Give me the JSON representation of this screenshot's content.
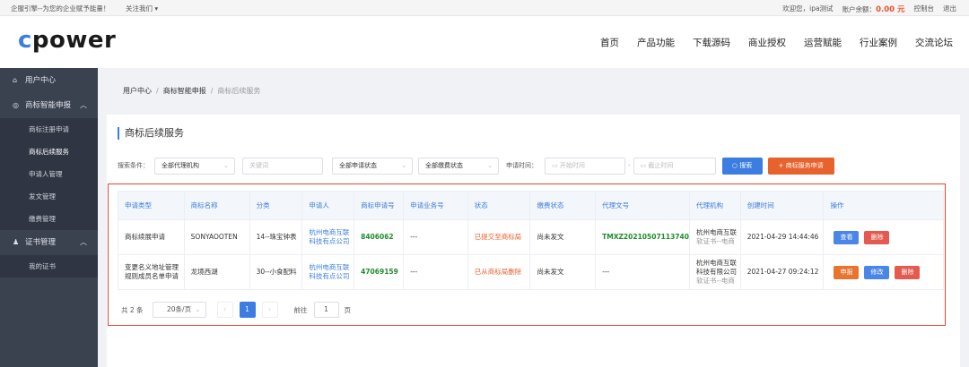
{
  "topbar": {
    "slogan": "企服引擎--为您的企业赋予能量！",
    "follow": "关注我们",
    "welcome": "欢迎您，",
    "username": "ipa测试",
    "balance_label": "账户余额：",
    "balance": "0.00 元",
    "console": "控制台",
    "logout": "退出"
  },
  "logo": {
    "c": "c",
    "rest": "power"
  },
  "nav": [
    "首页",
    "产品功能",
    "下载源码",
    "商业授权",
    "运营赋能",
    "行业案例",
    "交流论坛"
  ],
  "sidebar": {
    "user_center": "用户中心",
    "trademark": "商标智能申报",
    "trademark_items": [
      "商标注册申请",
      "商标后续服务",
      "申请人管理",
      "发文管理",
      "缴费管理"
    ],
    "certificate": "证书管理",
    "certificate_items": [
      "我的证书"
    ]
  },
  "breadcrumb": [
    "用户中心",
    "商标智能申报",
    "商标后续服务"
  ],
  "panel_title": "商标后续服务",
  "filters": {
    "label": "搜索条件：",
    "agency": "全部代理机构",
    "keyword_placeholder": "关键词",
    "apply_status": "全部申请状态",
    "pay_status": "全部缴费状态",
    "time_label": "申请时间：",
    "start_placeholder": "开始时间",
    "dash": "-",
    "end_placeholder": "截止时间",
    "search_btn": "搜索",
    "apply_btn": "+ 商标服务申请"
  },
  "table": {
    "headers": [
      "申请类型",
      "商标名称",
      "分类",
      "申请人",
      "商标申请号",
      "申请业务号",
      "状态",
      "缴费状态",
      "代理文号",
      "代理机构",
      "创建时间",
      "操作"
    ],
    "rows": [
      {
        "type": "商标续展申请",
        "name": "SONYAOOTEN",
        "category": "14--珠宝钟表",
        "applicant": "杭州电商互联科技有点公司",
        "app_no": "8406062",
        "biz_no": "---",
        "status": "已提交至商标局",
        "pay_status": "尚未发文",
        "doc_no": "TMXZ20210507113740",
        "agency": "杭州电商互联",
        "agency_sub": "软证书--电商",
        "created": "2021-04-29 14:44:46",
        "ops": [
          "查看",
          "删除"
        ]
      },
      {
        "type": "变更名义地址管理规则成员名单申请",
        "name": "龙境西湖",
        "category": "30--小食配料",
        "applicant": "杭州电商互联科技有点公司",
        "app_no": "47069159",
        "biz_no": "---",
        "status": "已从商标局删除",
        "pay_status": "尚未发文",
        "doc_no": "---",
        "agency": "杭州电商互联科技有限公司",
        "agency_sub": "软证书--电商",
        "created": "2021-04-27 09:24:12",
        "ops": [
          "申报",
          "修改",
          "删除"
        ]
      }
    ]
  },
  "pager": {
    "total": "共 2 条",
    "page_size": "20条/页",
    "current": "1",
    "goto": "前往",
    "goto_value": "1",
    "page_unit": "页"
  },
  "colors": {
    "accent": "#3b7de0",
    "sidebar": "#3a414f",
    "highlight_border": "#e0462f",
    "orange": "#e8622e"
  }
}
